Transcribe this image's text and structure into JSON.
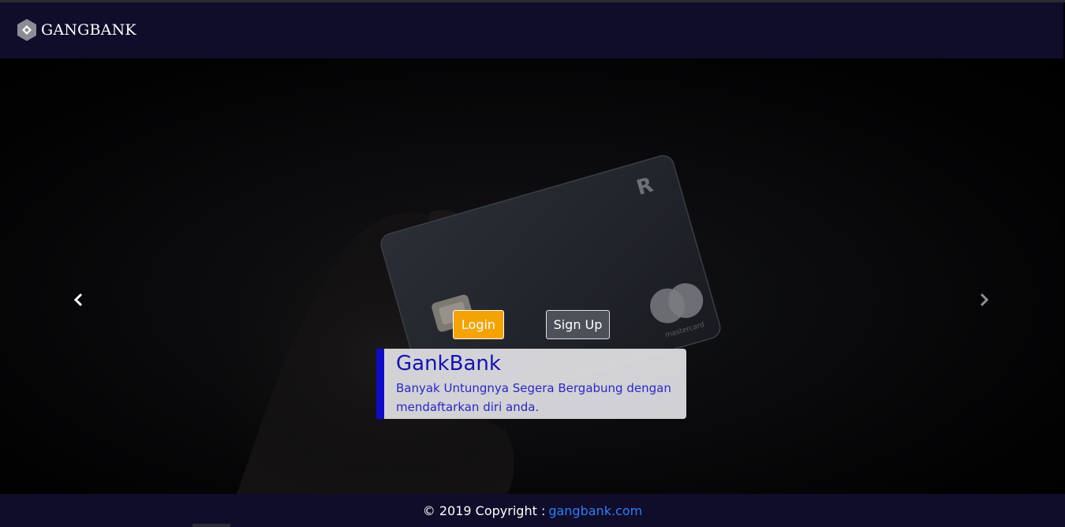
{
  "navbar": {
    "brand_text": "GANGBANK",
    "logo_icon": "hexagon-diamond-icon"
  },
  "carousel": {
    "prev_icon": "chevron-left-icon",
    "next_icon": "chevron-right-icon",
    "login_label": "Login",
    "signup_label": "Sign Up",
    "caption_title": "GankBank",
    "caption_text": "Banyak Untungnya Segera Bergabung dengan mendaftarkan diri anda."
  },
  "footer": {
    "copyright_text": "© 2019 Copyright :",
    "link_text": "gangbank.com"
  },
  "colors": {
    "navbar_bg": "#0f0d2a",
    "login_bg": "#f5a300",
    "signup_bg": "#4c5059",
    "caption_accent": "#0f0bc9",
    "link": "#2f7cf6"
  }
}
